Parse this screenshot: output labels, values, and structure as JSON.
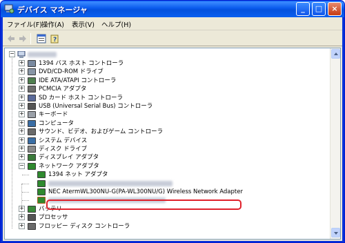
{
  "window": {
    "title": "デバイス マネージャ",
    "controls": {
      "minimize": "_",
      "maximize": "□",
      "close": "×"
    }
  },
  "menubar": {
    "items": [
      {
        "label": "ファイル(F)"
      },
      {
        "label": "操作(A)"
      },
      {
        "label": "表示(V)"
      },
      {
        "label": "ヘルプ(H)"
      }
    ]
  },
  "toolbar": {
    "icons": [
      "back-arrow-icon",
      "forward-arrow-icon",
      "properties-view-icon",
      "help-icon"
    ]
  },
  "tree": {
    "items": [
      {
        "label": "1394 バス ホスト コントローラ",
        "icon": "firewire-icon",
        "color": "#7a8aa0",
        "expander": "+"
      },
      {
        "label": "DVD/CD-ROM ドライブ",
        "icon": "cd-drive-icon",
        "color": "#8896a6",
        "expander": "+"
      },
      {
        "label": "IDE ATA/ATAPI コントローラ",
        "icon": "ide-controller-icon",
        "color": "#4f7f4f",
        "expander": "+"
      },
      {
        "label": "PCMCIA アダプタ",
        "icon": "pcmcia-icon",
        "color": "#6e6e6e",
        "expander": "+"
      },
      {
        "label": "SD カード ホスト コントローラ",
        "icon": "sd-card-icon",
        "color": "#5a6a9a",
        "expander": "+"
      },
      {
        "label": "USB (Universal Serial Bus) コントローラ",
        "icon": "usb-icon",
        "color": "#555555",
        "expander": "+"
      },
      {
        "label": "キーボード",
        "icon": "keyboard-icon",
        "color": "#9aa0a8",
        "expander": "+"
      },
      {
        "label": "コンピュータ",
        "icon": "computer-icon",
        "color": "#3a6ea5",
        "expander": "+"
      },
      {
        "label": "サウンド、ビデオ、およびゲーム コントローラ",
        "icon": "sound-icon",
        "color": "#6a6a6a",
        "expander": "+"
      },
      {
        "label": "システム デバイス",
        "icon": "system-device-icon",
        "color": "#3a6ea5",
        "expander": "+"
      },
      {
        "label": "ディスク ドライブ",
        "icon": "disk-drive-icon",
        "color": "#8a8a8a",
        "expander": "+"
      },
      {
        "label": "ディスプレイ アダプタ",
        "icon": "display-adapter-icon",
        "color": "#3a7a3a",
        "expander": "+"
      },
      {
        "label": "ネットワーク アダプタ",
        "icon": "network-adapter-icon",
        "color": "#2f8a2f",
        "expander": "−"
      },
      {
        "label": "1394 ネット アダプタ",
        "icon": "network-card-icon",
        "color": "#2f8a2f",
        "expander": ""
      },
      {
        "label": "",
        "icon": "network-card-icon",
        "color": "#2f8a2f",
        "expander": "",
        "blurred": true
      },
      {
        "label": "NEC AtermWL300NU-G(PA-WL300NU/G) Wireless Network Adapter",
        "icon": "network-card-icon",
        "color": "#2f8a2f",
        "expander": ""
      },
      {
        "label": "",
        "icon": "network-card-warning-icon",
        "color": "#2f8a2f",
        "expander": "",
        "blurred": true
      },
      {
        "label": "バッテリ",
        "icon": "battery-icon",
        "color": "#3a8a3a",
        "expander": "+"
      },
      {
        "label": "プロセッサ",
        "icon": "processor-icon",
        "color": "#555555",
        "expander": "+"
      },
      {
        "label": "フロッピー ディスク コントローラ",
        "icon": "floppy-controller-icon",
        "color": "#6a6a6a",
        "expander": "+"
      }
    ]
  },
  "colors": {
    "titlebar": "#0a5bee",
    "highlight": "#e0202a"
  }
}
